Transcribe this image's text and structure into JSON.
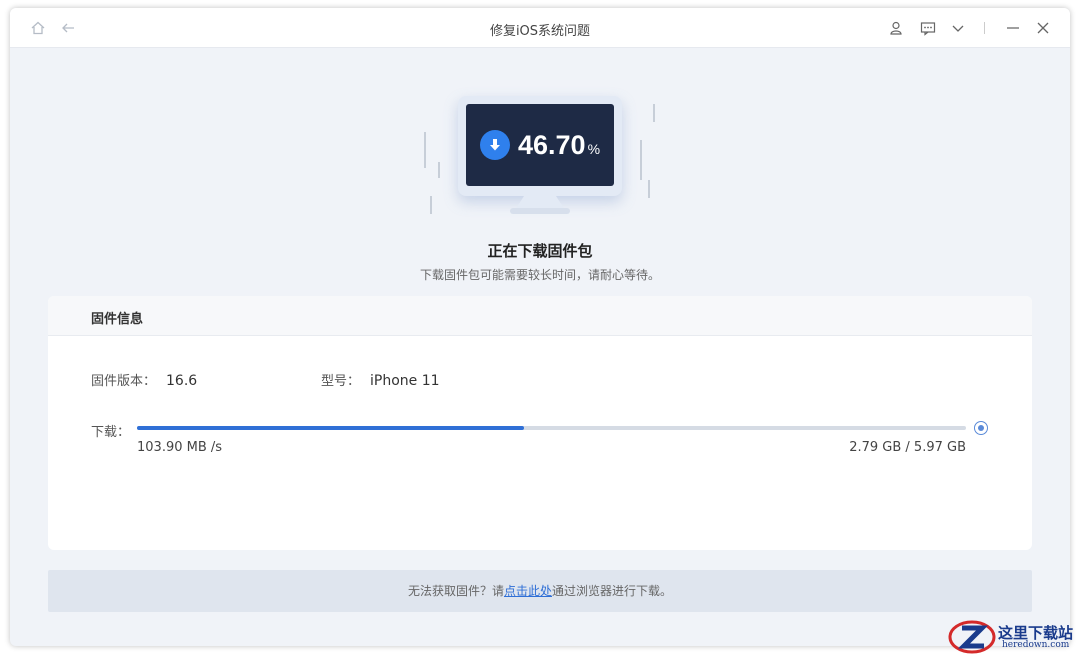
{
  "window": {
    "title": "修复iOS系统问题"
  },
  "titlebar": {
    "icons": [
      "home-icon",
      "back-icon",
      "user-icon",
      "feedback-icon",
      "chevron-down-icon",
      "minimize-icon",
      "close-icon"
    ]
  },
  "download": {
    "percent": "46.70",
    "percent_symbol": "%",
    "progress": 0.467,
    "title": "正在下载固件包",
    "subtitle": "下载固件包可能需要较长时间，请耐心等待。"
  },
  "firmware": {
    "section_title": "固件信息",
    "version_label": "固件版本：",
    "version_value": "16.6",
    "model_label": "型号：",
    "model_value": "iPhone 11",
    "download_label": "下载：",
    "speed": "103.90 MB /s",
    "size": "2.79 GB / 5.97 GB"
  },
  "footer": {
    "prefix": "无法获取固件？请",
    "link": "点击此处",
    "suffix": "通过浏览器进行下载。"
  },
  "watermark": {
    "text": "这里下载站",
    "url": "heredown.com"
  },
  "colors": {
    "accent": "#2f6fd6",
    "screen": "#1e2a45",
    "track": "#d5dbe4"
  }
}
